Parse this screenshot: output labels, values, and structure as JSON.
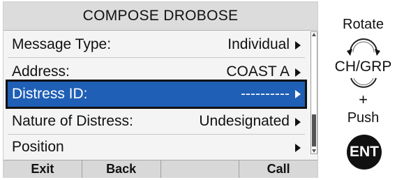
{
  "screen": {
    "title": "COMPOSE DROBOSE",
    "rows": [
      {
        "label": "Message Type:",
        "value": "Individual"
      },
      {
        "label": "Address:",
        "value": "COAST A"
      },
      {
        "label": "Distress ID:",
        "value": "----------"
      },
      {
        "label": "Nature of Distress:",
        "value": "Undesignated"
      },
      {
        "label": "Position",
        "value": ""
      }
    ],
    "selected_row": "Distress ID:",
    "softkeys": [
      "Exit",
      "Back",
      "",
      "Call"
    ],
    "colors": {
      "selection": "#1f5fb5",
      "title_bar": "#dcdcdc"
    }
  },
  "controls": {
    "rotate_label": "Rotate",
    "knob_label": "CH/GRP",
    "plus_label": "+",
    "push_label": "Push",
    "ent_label": "ENT"
  }
}
